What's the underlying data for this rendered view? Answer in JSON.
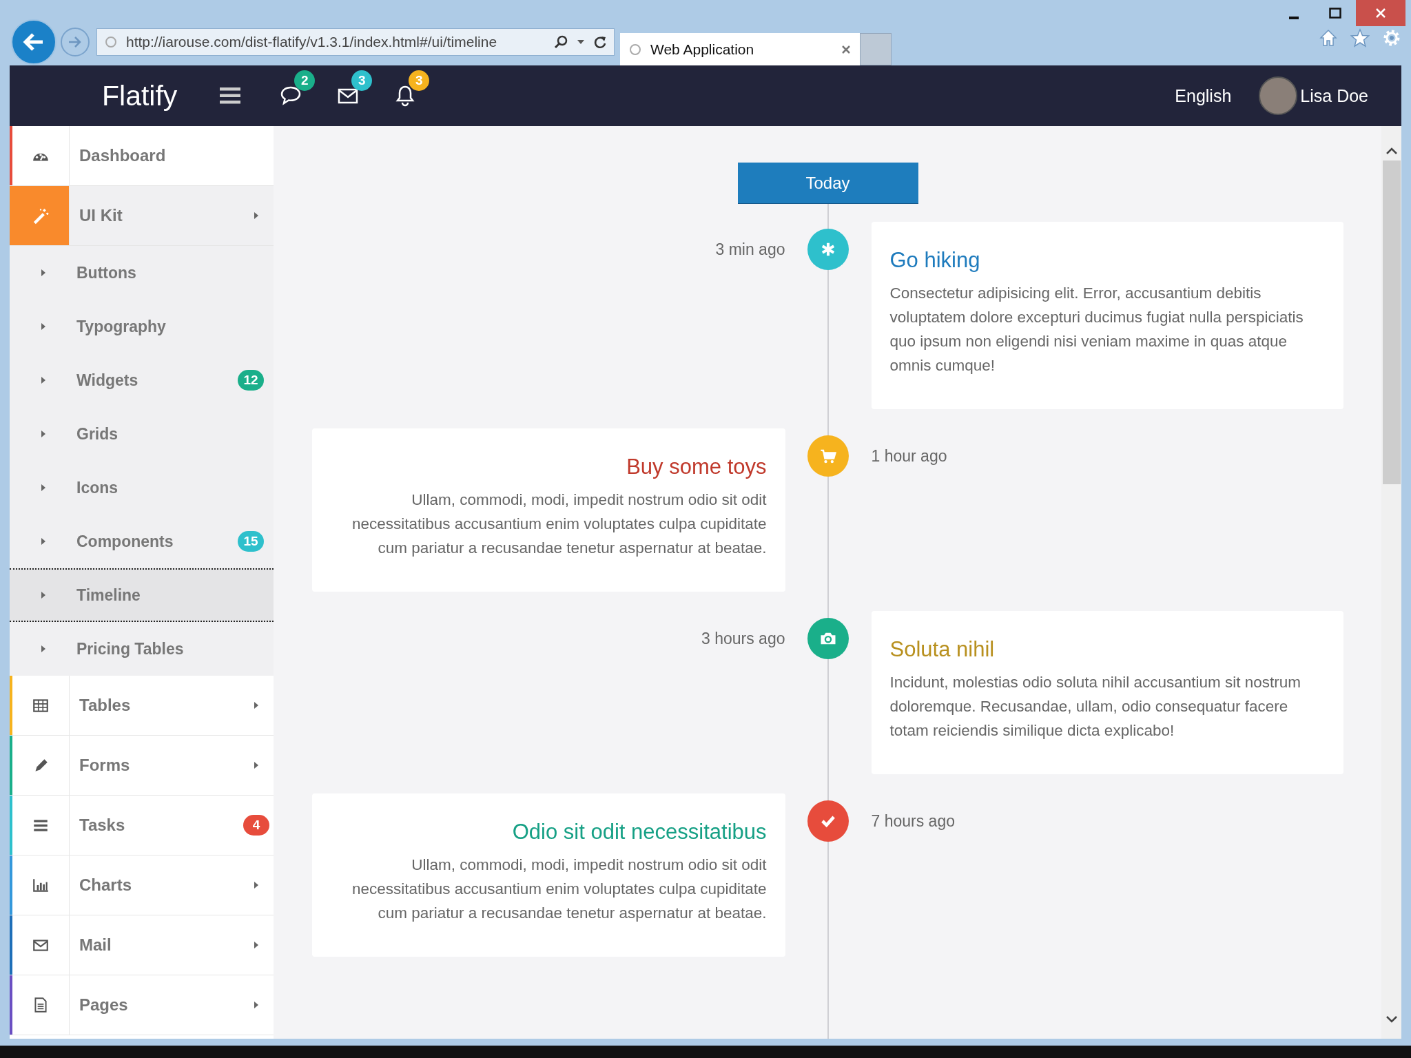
{
  "browser": {
    "url": "http://iarouse.com/dist-flatify/v1.3.1/index.html#/ui/timeline",
    "tab_title": "Web Application"
  },
  "header": {
    "brand": "Flatify",
    "notifications": [
      {
        "count": "2",
        "color": "#1aaf8a"
      },
      {
        "count": "3",
        "color": "#2ec0cc"
      },
      {
        "count": "3",
        "color": "#f6b31e"
      }
    ],
    "language": "English",
    "user": "Lisa Doe"
  },
  "sidebar": {
    "items": [
      {
        "label": "Dashboard",
        "color": "#e74c3c",
        "submenu": false,
        "expanded": false
      },
      {
        "label": "UI Kit",
        "color": "#f98a2c",
        "submenu": true,
        "expanded": true,
        "children": [
          {
            "label": "Buttons",
            "selected": false
          },
          {
            "label": "Typography",
            "selected": false
          },
          {
            "label": "Widgets",
            "selected": false,
            "badge": {
              "text": "12",
              "color": "#1aaf8a"
            }
          },
          {
            "label": "Grids",
            "selected": false
          },
          {
            "label": "Icons",
            "selected": false
          },
          {
            "label": "Components",
            "selected": false,
            "badge": {
              "text": "15",
              "color": "#2ec0cc"
            }
          },
          {
            "label": "Timeline",
            "selected": true
          },
          {
            "label": "Pricing Tables",
            "selected": false
          }
        ]
      },
      {
        "label": "Tables",
        "color": "#f6b31e",
        "submenu": true,
        "expanded": false
      },
      {
        "label": "Forms",
        "color": "#1aaf8a",
        "submenu": true,
        "expanded": false
      },
      {
        "label": "Tasks",
        "color": "#2ec0cc",
        "submenu": false,
        "expanded": false,
        "badge": {
          "text": "4",
          "color": "#e74c3c"
        }
      },
      {
        "label": "Charts",
        "color": "#3498db",
        "submenu": true,
        "expanded": false
      },
      {
        "label": "Mail",
        "color": "#1e6fb8",
        "submenu": true,
        "expanded": false
      },
      {
        "label": "Pages",
        "color": "#6a4fc2",
        "submenu": true,
        "expanded": false
      }
    ]
  },
  "timeline": {
    "today": "Today",
    "events": [
      {
        "kind": "right",
        "time": "3 min ago",
        "icon": {
          "color": "#2ec0cc"
        },
        "title": {
          "text": "Go hiking",
          "color": "#1e7bbd"
        },
        "text": "Consectetur adipisicing elit. Error, accusantium debitis voluptatem dolore excepturi ducimus fugiat nulla perspiciatis quo ipsum non eligendi nisi veniam maxime in quas atque omnis cumque!"
      },
      {
        "kind": "left",
        "time": "1 hour ago",
        "icon": {
          "color": "#f6b31e"
        },
        "title": {
          "text": "Buy some toys",
          "color": "#c0392b"
        },
        "text": "Ullam, commodi, modi, impedit nostrum odio sit odit necessitatibus accusantium enim voluptates culpa cupiditate cum pariatur a recusandae tenetur aspernatur at beatae."
      },
      {
        "kind": "right",
        "time": "3 hours ago",
        "icon": {
          "color": "#1aaf8a"
        },
        "title": {
          "text": "Soluta nihil",
          "color": "#b8901e"
        },
        "text": "Incidunt, molestias odio soluta nihil accusantium sit nostrum doloremque. Recusandae, ullam, odio consequatur facere totam reiciendis similique dicta explicabo!"
      },
      {
        "kind": "left",
        "time": "7 hours ago",
        "icon": {
          "color": "#e74c3c"
        },
        "title": {
          "text": "Odio sit odit necessitatibus",
          "color": "#16a085"
        },
        "text": "Ullam, commodi, modi, impedit nostrum odio sit odit necessitatibus accusantium enim voluptates culpa cupiditate cum pariatur a recusandae tenetur aspernatur at beatae."
      }
    ]
  }
}
